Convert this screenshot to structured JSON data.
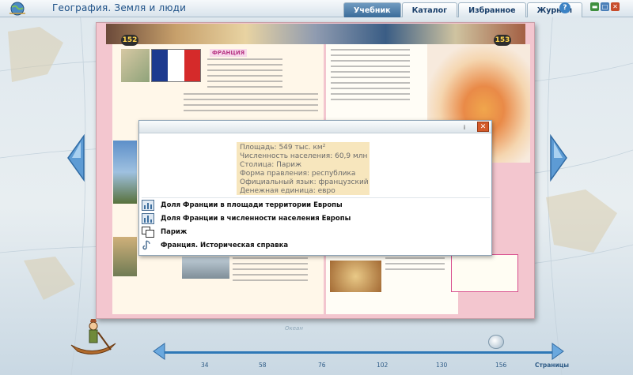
{
  "window": {
    "title": "География. Земля и люди",
    "help_icon": "?"
  },
  "tabs": [
    {
      "label": "Учебник",
      "active": true
    },
    {
      "label": "Каталог",
      "active": false
    },
    {
      "label": "Избранное",
      "active": false
    },
    {
      "label": "Журнал",
      "active": false
    }
  ],
  "book": {
    "left_page_number": "152",
    "right_page_number": "153",
    "section_title": "ФРАНЦИЯ"
  },
  "dialog": {
    "info_button": "i",
    "close_button": "✕",
    "facts": [
      "Площадь: 549 тыс. км²",
      "Численность населения: 60,9 млн чел.",
      "Столица: Париж",
      "Форма правления: республика",
      "Официальный язык: французский",
      "Денежная единица: евро"
    ],
    "links": [
      {
        "label": "Доля Франции в площади территории Европы",
        "icon": "chart-icon"
      },
      {
        "label": "Доля Франции в численности населения Европы",
        "icon": "chart-icon"
      },
      {
        "label": "Париж",
        "icon": "pages-icon"
      },
      {
        "label": "Франция. Историческая справка",
        "icon": "info-sound-icon"
      }
    ]
  },
  "bottom_nav": {
    "ocean_label": "Океан",
    "ticks": [
      "34",
      "58",
      "76",
      "102",
      "130",
      "156"
    ],
    "pages_label": "Страницы"
  },
  "colors": {
    "active_tab": "#3b6c9a",
    "book_border": "#f3c6cf",
    "facts_highlight": "#f7e6bd",
    "timeline": "#2e78b6"
  }
}
